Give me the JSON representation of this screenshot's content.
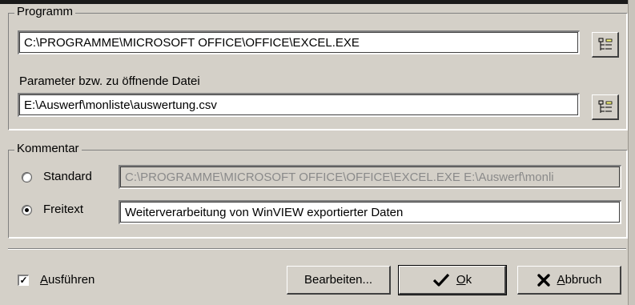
{
  "programm": {
    "legend": "Programm",
    "path": "C:\\PROGRAMME\\MICROSOFT OFFICE\\OFFICE\\EXCEL.EXE",
    "parameter_label": "Parameter bzw. zu öffnende Datei",
    "parameter_value": "E:\\Auswerf\\monliste\\auswertung.csv"
  },
  "kommentar": {
    "legend": "Kommentar",
    "standard_label": "Standard",
    "standard_value": "C:\\PROGRAMME\\MICROSOFT OFFICE\\OFFICE\\EXCEL.EXE E:\\Auswerf\\monli",
    "freitext_label": "Freitext",
    "freitext_value": "Weiterverarbeitung von WinVIEW exportierter Daten",
    "selected": "freitext"
  },
  "footer": {
    "ausfuehren_label": "Ausführen",
    "ausfuehren_checked": true,
    "bearbeiten_label": "Bearbeiten...",
    "ok_label": "Ok",
    "abbruch_label": "Abbruch"
  },
  "icons": {
    "browse": "folder-tree-icon",
    "ok": "checkmark-icon",
    "cancel": "x-icon"
  }
}
